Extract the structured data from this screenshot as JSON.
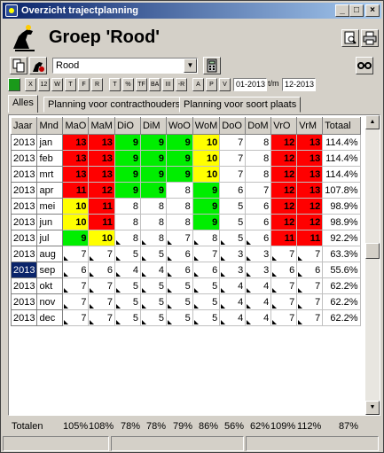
{
  "window": {
    "title": "Overzicht trajectplanning"
  },
  "header": {
    "group_title": "Groep 'Rood'"
  },
  "toolbar": {
    "group_select_value": "Rood"
  },
  "filters": {
    "buttons": [
      "X",
      "12",
      "W",
      "T",
      "F",
      "R",
      "T",
      "%",
      "TF",
      "BA",
      "III",
      "-R",
      "A",
      "P",
      "V"
    ],
    "date_from": "01-2013",
    "date_sep": "t/m",
    "date_to": "12-2013"
  },
  "tabs": [
    "Alles",
    "Planning voor contracthouders",
    "Planning voor soort plaats"
  ],
  "table": {
    "columns": [
      "Jaar",
      "Mnd",
      "MaO",
      "MaM",
      "DiO",
      "DiM",
      "WoO",
      "WoM",
      "DoO",
      "DoM",
      "VrO",
      "VrM",
      "Totaal"
    ],
    "rows": [
      {
        "jaar": "2013",
        "mnd": "jan",
        "cells": [
          "13",
          "13",
          "9",
          "9",
          "9",
          "10",
          "7",
          "8",
          "12",
          "13"
        ],
        "colors": [
          "red",
          "red",
          "green",
          "green",
          "green",
          "yellow",
          "",
          "",
          "red",
          "red"
        ],
        "totaal": "114.4%"
      },
      {
        "jaar": "2013",
        "mnd": "feb",
        "cells": [
          "13",
          "13",
          "9",
          "9",
          "9",
          "10",
          "7",
          "8",
          "12",
          "13"
        ],
        "colors": [
          "red",
          "red",
          "green",
          "green",
          "green",
          "yellow",
          "",
          "",
          "red",
          "red"
        ],
        "totaal": "114.4%"
      },
      {
        "jaar": "2013",
        "mnd": "mrt",
        "cells": [
          "13",
          "13",
          "9",
          "9",
          "9",
          "10",
          "7",
          "8",
          "12",
          "13"
        ],
        "colors": [
          "red",
          "red",
          "green",
          "green",
          "green",
          "yellow",
          "",
          "",
          "red",
          "red"
        ],
        "totaal": "114.4%"
      },
      {
        "jaar": "2013",
        "mnd": "apr",
        "cells": [
          "11",
          "12",
          "9",
          "9",
          "8",
          "9",
          "6",
          "7",
          "12",
          "13"
        ],
        "colors": [
          "red",
          "red",
          "green",
          "green",
          "",
          "green",
          "",
          "",
          "red",
          "red"
        ],
        "totaal": "107.8%"
      },
      {
        "jaar": "2013",
        "mnd": "mei",
        "cells": [
          "10",
          "11",
          "8",
          "8",
          "8",
          "9",
          "5",
          "6",
          "12",
          "12"
        ],
        "colors": [
          "yellow",
          "red",
          "",
          "",
          "",
          "green",
          "",
          "",
          "red",
          "red"
        ],
        "totaal": "98.9%"
      },
      {
        "jaar": "2013",
        "mnd": "jun",
        "cells": [
          "10",
          "11",
          "8",
          "8",
          "8",
          "9",
          "5",
          "6",
          "12",
          "12"
        ],
        "colors": [
          "yellow",
          "red",
          "",
          "",
          "",
          "green",
          "",
          "",
          "red",
          "red"
        ],
        "totaal": "98.9%"
      },
      {
        "jaar": "2013",
        "mnd": "jul",
        "cells": [
          "9",
          "10",
          "8",
          "8",
          "7",
          "8",
          "5",
          "6",
          "11",
          "11"
        ],
        "colors": [
          "green",
          "yellow",
          "",
          "",
          "",
          "",
          "",
          "",
          "red",
          "red"
        ],
        "totaal": "92.2%"
      },
      {
        "jaar": "2013",
        "mnd": "aug",
        "cells": [
          "7",
          "7",
          "5",
          "5",
          "6",
          "7",
          "3",
          "3",
          "7",
          "7"
        ],
        "colors": [
          "",
          "",
          "",
          "",
          "",
          "",
          "",
          "",
          "",
          ""
        ],
        "totaal": "63.3%"
      },
      {
        "jaar": "2013",
        "mnd": "sep",
        "cells": [
          "6",
          "6",
          "4",
          "4",
          "6",
          "6",
          "3",
          "3",
          "6",
          "6"
        ],
        "colors": [
          "",
          "",
          "",
          "",
          "",
          "",
          "",
          "",
          "",
          ""
        ],
        "totaal": "55.6%"
      },
      {
        "jaar": "2013",
        "mnd": "okt",
        "cells": [
          "7",
          "7",
          "5",
          "5",
          "5",
          "5",
          "4",
          "4",
          "7",
          "7"
        ],
        "colors": [
          "",
          "",
          "",
          "",
          "",
          "",
          "",
          "",
          "",
          ""
        ],
        "totaal": "62.2%"
      },
      {
        "jaar": "2013",
        "mnd": "nov",
        "cells": [
          "7",
          "7",
          "5",
          "5",
          "5",
          "5",
          "4",
          "4",
          "7",
          "7"
        ],
        "colors": [
          "",
          "",
          "",
          "",
          "",
          "",
          "",
          "",
          "",
          ""
        ],
        "totaal": "62.2%"
      },
      {
        "jaar": "2013",
        "mnd": "dec",
        "cells": [
          "7",
          "7",
          "5",
          "5",
          "5",
          "5",
          "4",
          "4",
          "7",
          "7"
        ],
        "colors": [
          "",
          "",
          "",
          "",
          "",
          "",
          "",
          "",
          "",
          ""
        ],
        "totaal": "62.2%"
      }
    ],
    "selected_row": 8
  },
  "totals": {
    "label": "Totalen",
    "values": [
      "105%",
      "108%",
      "78%",
      "78%",
      "79%",
      "86%",
      "56%",
      "62%",
      "109%",
      "112%",
      "87%"
    ]
  },
  "colors": {
    "red": "#ff0000",
    "green": "#00ee00",
    "yellow": "#ffff00",
    "title_start": "#0a246a",
    "title_end": "#a6caf0"
  }
}
